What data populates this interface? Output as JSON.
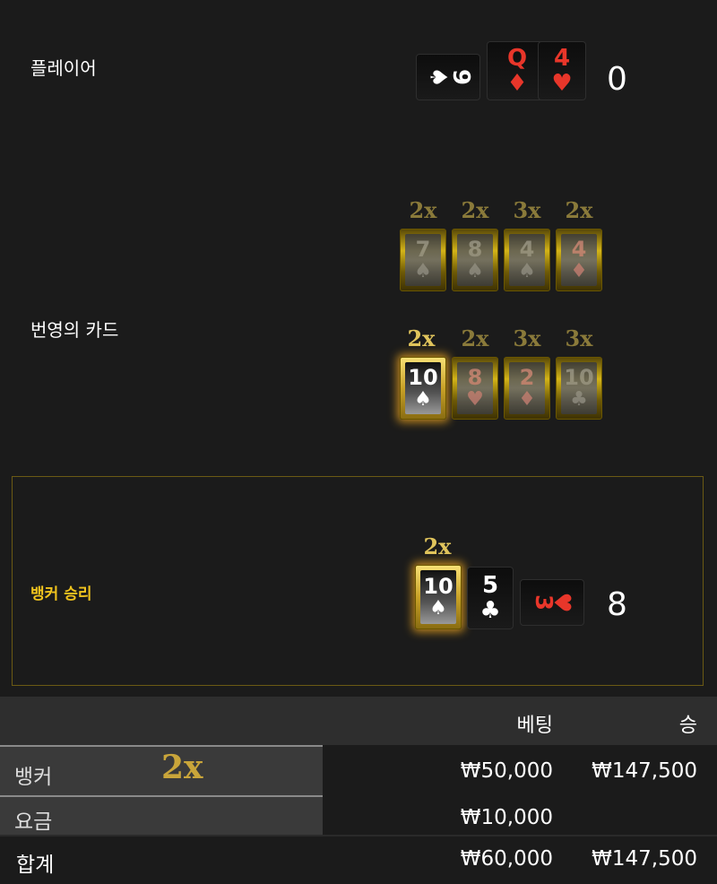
{
  "player": {
    "label": "플레이어",
    "score": "0",
    "cards": [
      {
        "rank": "9",
        "suit": "♠",
        "color": "black",
        "sideways": true
      },
      {
        "rank": "Q",
        "suit": "♦",
        "color": "red",
        "sideways": false
      },
      {
        "rank": "4",
        "suit": "♥",
        "color": "red",
        "sideways": false
      }
    ]
  },
  "lightning": {
    "label": "번영의 카드",
    "row1": [
      {
        "mult": "2x",
        "rank": "7",
        "suit": "♠",
        "color": "black",
        "active": false
      },
      {
        "mult": "2x",
        "rank": "8",
        "suit": "♠",
        "color": "black",
        "active": false
      },
      {
        "mult": "3x",
        "rank": "4",
        "suit": "♠",
        "color": "black",
        "active": false
      },
      {
        "mult": "2x",
        "rank": "4",
        "suit": "♦",
        "color": "red",
        "active": false
      }
    ],
    "row2": [
      {
        "mult": "2x",
        "rank": "10",
        "suit": "♠",
        "color": "black",
        "active": true
      },
      {
        "mult": "2x",
        "rank": "8",
        "suit": "♥",
        "color": "red",
        "active": false
      },
      {
        "mult": "3x",
        "rank": "2",
        "suit": "♦",
        "color": "red",
        "active": false
      },
      {
        "mult": "3x",
        "rank": "10",
        "suit": "♣",
        "color": "black",
        "active": false
      }
    ]
  },
  "banker": {
    "label": "뱅커 승리",
    "score": "8",
    "card_mult": "2x",
    "cards": [
      {
        "rank": "10",
        "suit": "♠",
        "color": "black",
        "lightning": true
      },
      {
        "rank": "5",
        "suit": "♣",
        "color": "black",
        "lightning": false
      },
      {
        "rank": "3",
        "suit": "♥",
        "color": "red",
        "sideways": true
      }
    ]
  },
  "table": {
    "header_bet": "베팅",
    "header_win": "승",
    "rows": [
      {
        "label": "뱅커",
        "mult": "2x",
        "bet": "₩50,000",
        "win": "₩147,500"
      },
      {
        "label": "요금",
        "mult": "",
        "bet": "₩10,000",
        "win": ""
      },
      {
        "label": "합계",
        "mult": "",
        "bet": "₩60,000",
        "win": "₩147,500"
      }
    ]
  },
  "colors": {
    "gold": "#f0c31e",
    "red_suit": "#e8362a",
    "background": "#1b1b1b"
  }
}
